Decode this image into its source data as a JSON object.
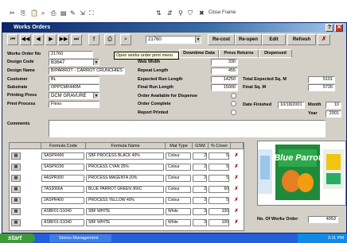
{
  "topbar": {
    "close_label": "Close Frame"
  },
  "window": {
    "title": "Works Orders"
  },
  "toolbar": {
    "order_combo": "21760",
    "buttons": [
      "Re-cost",
      "Re-open",
      "Edit",
      "Refresh"
    ],
    "tooltip": "Open works order print menu"
  },
  "tabs": [
    "Downtime Data",
    "Press Returns",
    "Dispensed"
  ],
  "form": {
    "works_order_no": {
      "label": "Works Order No",
      "value": "21760"
    },
    "design_code": {
      "label": "Design Code",
      "value": "B3647"
    },
    "design_name": {
      "label": "Design Name",
      "value": "B/PARROT - CARROT CRUNCHIES"
    },
    "customer": {
      "label": "Customer",
      "value": "BL"
    },
    "substrate": {
      "label": "Substrate",
      "value": "OPPCM0440M"
    },
    "printing_press": {
      "label": "Printing Press",
      "value": "DCM GRAVURE"
    },
    "print_process": {
      "label": "Print Process",
      "value": "Flexo"
    },
    "comments": {
      "label": "Comments",
      "value": ""
    },
    "web_width": {
      "label": "Web Width",
      "value": "330"
    },
    "repeat_length": {
      "label": "Repeat Length",
      "value": "455"
    },
    "expected_run_length": {
      "label": "Expected Run Length",
      "value": "14250"
    },
    "final_run_length": {
      "label": "Final Run Length",
      "value": "15000"
    },
    "order_available": {
      "label": "Order Available for Dispense"
    },
    "order_complete": {
      "label": "Order Complete"
    },
    "report_printed": {
      "label": "Report Printed"
    },
    "expected_total_sq": {
      "label": "Total Expected Sq. M",
      "value": "5101"
    },
    "final_sq": {
      "label": "Final Sq. M",
      "value": "5726"
    },
    "date_finished": {
      "label": "Date Finished",
      "value": "10/18/2001"
    },
    "month": {
      "label": "Month",
      "value": "10"
    },
    "year": {
      "label": "Year",
      "value": "2001"
    }
  },
  "grid": {
    "headers": [
      "Formula Code",
      "Formula Name",
      "Mat Type",
      "GSM",
      "% Cover"
    ],
    "rows": [
      {
        "code": "SASPR400",
        "name": "SBF PROCESS BLACK 40%",
        "mat": "Colour",
        "gsm": "2",
        "cover": "5"
      },
      {
        "code": "SASPR200",
        "name": "PROCESS CYAN 25%",
        "mat": "Colour",
        "gsm": "2",
        "cover": "5"
      },
      {
        "code": "4ASPR300",
        "name": "PROCESS MAGENTA 20%",
        "mat": "Colour",
        "gsm": "2",
        "cover": "5"
      },
      {
        "code": "7AS3066A",
        "name": "BLUE PARROT GREEN 366C",
        "mat": "Colour",
        "gsm": "2",
        "cover": "60"
      },
      {
        "code": "2ASPR400",
        "name": "PROCESS YELLOW 40%",
        "mat": "Colour",
        "gsm": "2",
        "cover": "5"
      },
      {
        "code": "ASBF01-S1040",
        "name": "SBF WHITE",
        "mat": "White",
        "gsm": "3",
        "cover": "100"
      },
      {
        "code": "ASBF01-S1040",
        "name": "SBF WHITE",
        "mat": "White",
        "gsm": "3",
        "cover": "100"
      }
    ],
    "works_orders_label": "No. Of Works Order",
    "works_orders_value": "4053"
  },
  "image": {
    "brand": "Blue Parrot",
    "accent": "#1f8a3a"
  },
  "taskbar": {
    "start": "start",
    "item": "Stores Management",
    "clock": "3:11 PM"
  }
}
